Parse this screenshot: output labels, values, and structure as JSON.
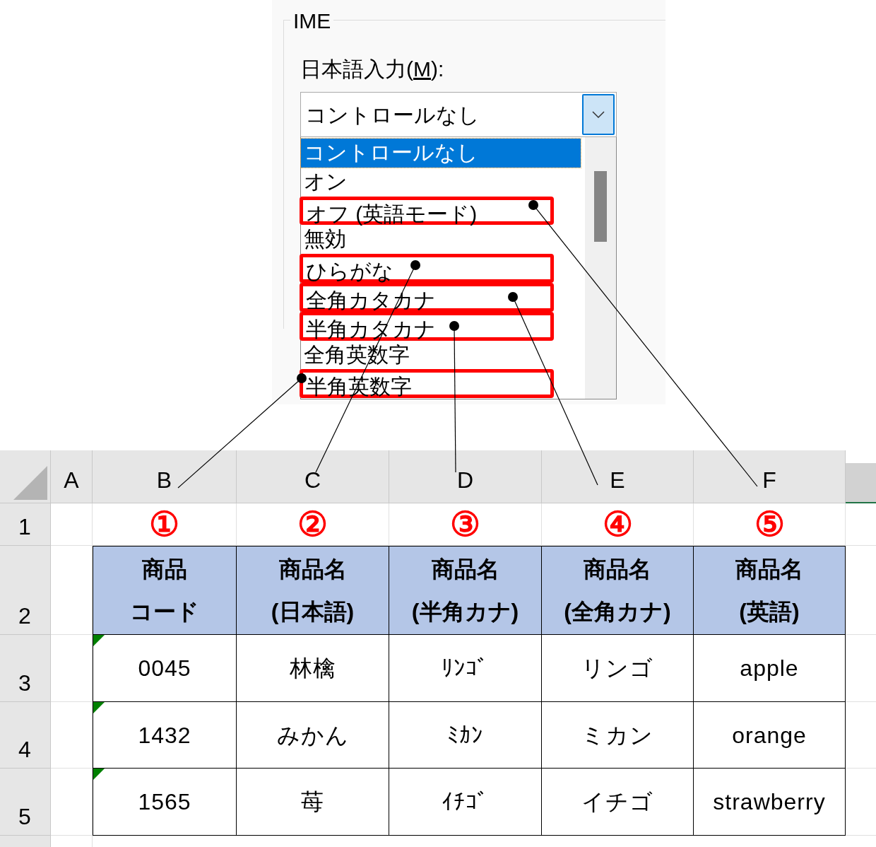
{
  "ime_panel": {
    "group_title": "IME",
    "label_before": "日本語入力(",
    "access_key": "M",
    "label_after": "):",
    "combo": {
      "value": "コントロールなし"
    },
    "options": [
      {
        "label": "コントロールなし",
        "selected": true,
        "highlighted": false
      },
      {
        "label": "オン",
        "selected": false,
        "highlighted": false
      },
      {
        "label": "オフ (英語モード)",
        "selected": false,
        "highlighted": true
      },
      {
        "label": "無効",
        "selected": false,
        "highlighted": false
      },
      {
        "label": "ひらがな",
        "selected": false,
        "highlighted": true
      },
      {
        "label": "全角カタカナ",
        "selected": false,
        "highlighted": true
      },
      {
        "label": "半角カタカナ",
        "selected": false,
        "highlighted": true
      },
      {
        "label": "全角英数字",
        "selected": false,
        "highlighted": false
      },
      {
        "label": "半角英数字",
        "selected": false,
        "highlighted": true
      }
    ]
  },
  "sheet": {
    "column_headers": [
      "A",
      "B",
      "C",
      "D",
      "E",
      "F"
    ],
    "row_headers": [
      "1",
      "2",
      "3",
      "4",
      "5"
    ],
    "markers": [
      "①",
      "②",
      "③",
      "④",
      "⑤"
    ],
    "table_header": [
      [
        "商品",
        "コード"
      ],
      [
        "商品名",
        "(日本語)"
      ],
      [
        "商品名",
        "(半角カナ)"
      ],
      [
        "商品名",
        "(全角カナ)"
      ],
      [
        "商品名",
        "(英語)"
      ]
    ],
    "table_rows": [
      {
        "error_indicator": true,
        "cells": [
          "0045",
          "林檎",
          "ﾘﾝｺﾞ",
          "リンゴ",
          "apple"
        ]
      },
      {
        "error_indicator": true,
        "cells": [
          "1432",
          "みかん",
          "ﾐｶﾝ",
          "ミカン",
          "orange"
        ]
      },
      {
        "error_indicator": true,
        "cells": [
          "1565",
          "苺",
          "ｲﾁｺﾞ",
          "イチゴ",
          "strawberry"
        ]
      }
    ]
  }
}
